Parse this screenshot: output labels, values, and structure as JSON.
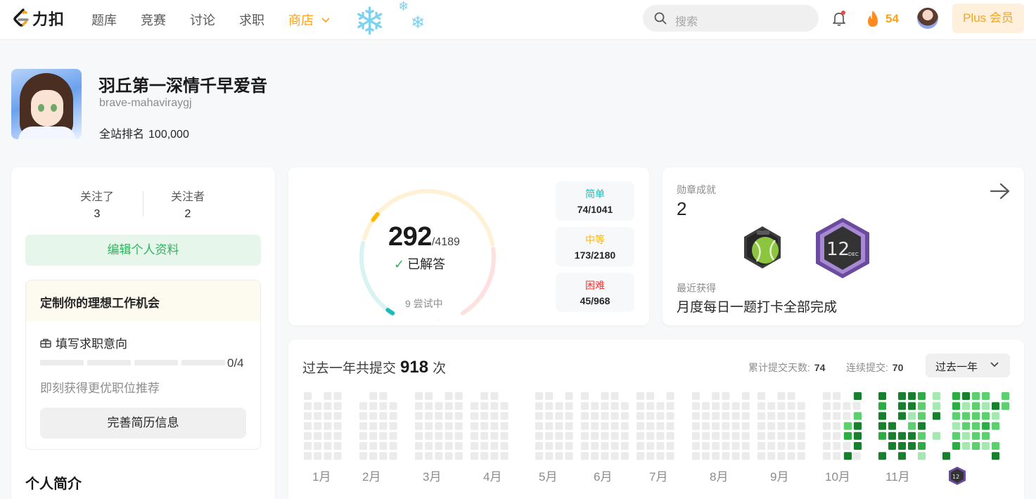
{
  "nav": {
    "logo_text": "力扣",
    "links": [
      "题库",
      "竞赛",
      "讨论",
      "求职"
    ],
    "store_label": "商店",
    "search_placeholder": "搜索",
    "streak_count": "54",
    "plus_label": "Plus 会员",
    "icons": [
      "leetcode-logo-icon",
      "chevron-down-icon",
      "snowflake-icon",
      "search-icon",
      "bell-icon",
      "flame-icon"
    ]
  },
  "profile": {
    "display_name": "羽丘第一深情千早爱音",
    "username": "brave-mahaviraygj",
    "rank_label": "全站排名",
    "rank_value": "100,000"
  },
  "social": {
    "following_label": "关注了",
    "following_count": "3",
    "followers_label": "关注者",
    "followers_count": "2",
    "edit_button": "编辑个人资料"
  },
  "job": {
    "title": "定制你的理想工作机会",
    "intent_label": "填写求职意向",
    "progress_text": "0/4",
    "progress_fraction": 0,
    "hint": "即刻获得更优职位推荐",
    "resume_button": "完善简历信息"
  },
  "bio_title": "个人简介",
  "solved": {
    "count": "292",
    "total": "/4189",
    "solved_label": "已解答",
    "attempting": "9 尝试中",
    "colors": {
      "easy": "#1cbaba",
      "medium": "#ffb700",
      "hard": "#f63737"
    },
    "difficulties": [
      {
        "label": "简单",
        "value": "74/1041"
      },
      {
        "label": "中等",
        "value": "173/2180"
      },
      {
        "label": "困难",
        "value": "45/968"
      }
    ]
  },
  "badges": {
    "label": "勋章成就",
    "count": "2",
    "recent_label": "最近获得",
    "recent_value": "月度每日一题打卡全部完成",
    "badge_names": [
      "tennis-badge-icon",
      "dec-12-badge-icon"
    ]
  },
  "calendar": {
    "title_prefix": "过去一年共提交",
    "submissions": "918",
    "title_suffix": "次",
    "total_days_label": "累计提交天数:",
    "total_days": "74",
    "streak_label": "连续提交:",
    "streak": "70",
    "range_select": "过去一年",
    "months": [
      "1月",
      "2月",
      "3月",
      "4月",
      "5月",
      "6月",
      "7月",
      "8月",
      "9月",
      "10月",
      "11月"
    ],
    "palette": [
      "#ebebeb",
      "#a6e8b2",
      "#5ccf6e",
      "#2cad44",
      "#17802d"
    ]
  }
}
